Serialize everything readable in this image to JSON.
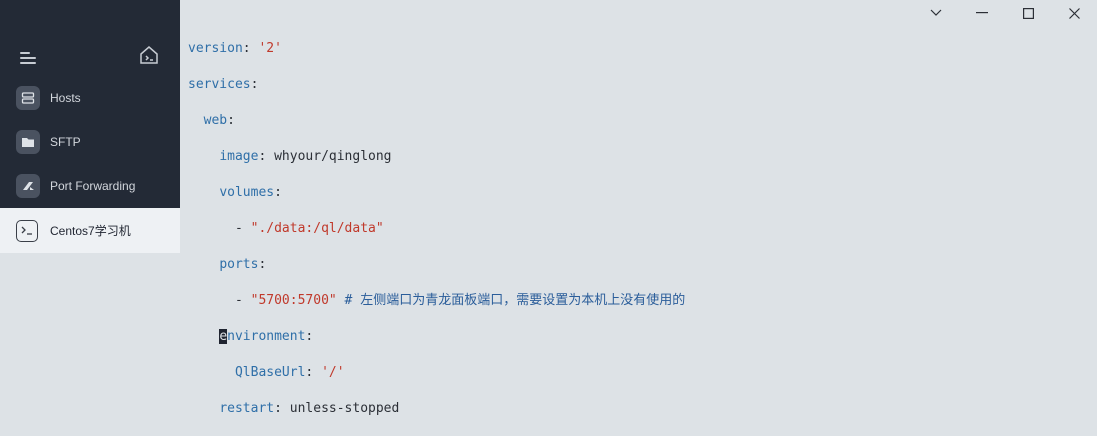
{
  "sidebar": {
    "items": [
      {
        "label": "Hosts",
        "icon": "hosts-icon"
      },
      {
        "label": "SFTP",
        "icon": "folder-icon"
      },
      {
        "label": "Port Forwarding",
        "icon": "forward-icon"
      }
    ],
    "active_host": {
      "label": "Centos7学习机",
      "icon": "terminal-icon"
    }
  },
  "editor": {
    "lines": [
      {
        "key": "version",
        "sep": ": ",
        "val": "'2'"
      },
      {
        "key": "services",
        "sep": ":"
      },
      {
        "indent": "  ",
        "key": "web",
        "sep": ":"
      },
      {
        "indent": "    ",
        "key": "image",
        "sep": ": ",
        "plain": "whyour/qinglong"
      },
      {
        "indent": "    ",
        "key": "volumes",
        "sep": ":"
      },
      {
        "indent": "      ",
        "dash": "- ",
        "val": "\"./data:/ql/data\""
      },
      {
        "indent": "    ",
        "key": "ports",
        "sep": ":"
      },
      {
        "indent": "      ",
        "dash": "- ",
        "val": "\"5700:5700\"",
        "comment": " # 左侧端口为青龙面板端口，需要设置为本机上没有使用的"
      },
      {
        "indent": "    ",
        "cursor_char": "e",
        "key": "nvironment",
        "sep": ":"
      },
      {
        "indent": "      ",
        "key": "QlBaseUrl",
        "sep": ": ",
        "val": "'/'"
      },
      {
        "indent": "    ",
        "key": "restart",
        "sep": ": ",
        "plain": "unless-stopped"
      }
    ]
  },
  "colors": {
    "sidebar_bg": "#232a36",
    "editor_bg": "#dde2e6",
    "key": "#2f6fa8",
    "string": "#c0392b"
  }
}
